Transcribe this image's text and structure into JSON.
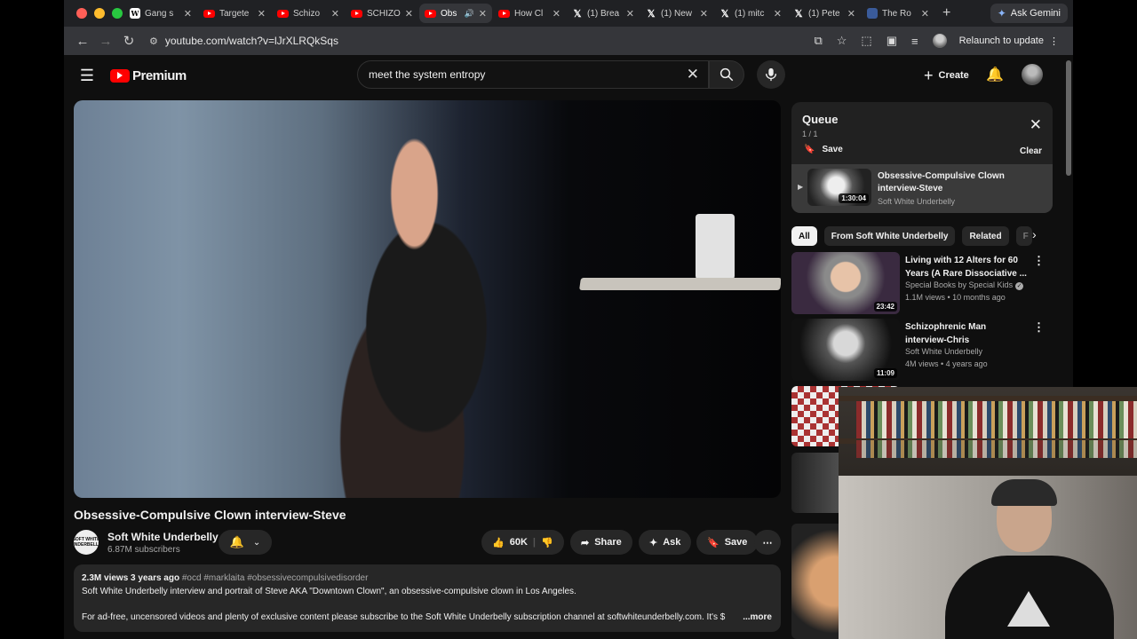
{
  "browser": {
    "tabs": [
      {
        "icon": "wikipedia-icon",
        "title": "Gang s",
        "active": false
      },
      {
        "icon": "youtube-icon",
        "title": "Targete",
        "active": false
      },
      {
        "icon": "youtube-icon",
        "title": "Schizo",
        "active": false
      },
      {
        "icon": "youtube-icon",
        "title": "SCHIZO",
        "active": false
      },
      {
        "icon": "youtube-icon",
        "title": "Obs",
        "active": true
      },
      {
        "icon": "youtube-icon",
        "title": "How Cl",
        "active": false
      },
      {
        "icon": "x-icon",
        "title": "(1) Brea",
        "active": false
      },
      {
        "icon": "x-icon",
        "title": "(1) New",
        "active": false
      },
      {
        "icon": "x-icon",
        "title": "(1) mitc",
        "active": false
      },
      {
        "icon": "x-icon",
        "title": "(1) Pete",
        "active": false
      },
      {
        "icon": "site-icon",
        "title": "The Ro",
        "active": false
      }
    ],
    "gemini_label": "Ask Gemini",
    "url": "youtube.com/watch?v=lJrXLRQkSqs",
    "relaunch_label": "Relaunch to update"
  },
  "yt": {
    "logo_text": "Premium",
    "search_value": "meet the system entropy",
    "create_label": "Create"
  },
  "video": {
    "title": "Obsessive-Compulsive Clown interview-Steve",
    "channel": "Soft White Underbelly",
    "channel_avatar_text": "SOFT WHITE UNDERBELLY",
    "subscribers": "6.87M subscribers",
    "likes": "60K",
    "share_label": "Share",
    "ask_label": "Ask",
    "save_label": "Save",
    "views": "2.3M views",
    "age": "3 years ago",
    "tags": "#ocd #marklaita #obsessivecompulsivedisorder",
    "description_1": "Soft White Underbelly interview and portrait of Steve AKA \"Downtown Clown\", an obsessive-compulsive clown in Los Angeles.",
    "description_2": "For ad-free, uncensored videos and plenty of exclusive content please subscribe to the Soft White Underbelly subscription channel at softwhiteunderbelly.com. It's $",
    "more_label": "...more"
  },
  "queue": {
    "title": "Queue",
    "count": "1 / 1",
    "save_label": "Save",
    "clear_label": "Clear",
    "item": {
      "title": "Obsessive-Compulsive Clown interview-Steve",
      "channel": "Soft White Underbelly",
      "duration": "1:30:04"
    }
  },
  "chips": [
    "All",
    "From Soft White Underbelly",
    "Related",
    "F"
  ],
  "recommendations": [
    {
      "title": "Living with 12 Alters for 60 Years (A Rare Dissociative ...",
      "channel": "Special Books by Special Kids",
      "meta": "1.1M views • 10 months ago",
      "duration": "23:42"
    },
    {
      "title": "Schizophrenic Man interview-Chris",
      "channel": "Soft White Underbelly",
      "meta": "4M views • 4 years ago",
      "duration": "11:09"
    }
  ],
  "colors": {
    "background": "#0f0f0f",
    "brand_red": "#ff0000",
    "chip_selected": "#f1f1f1"
  }
}
